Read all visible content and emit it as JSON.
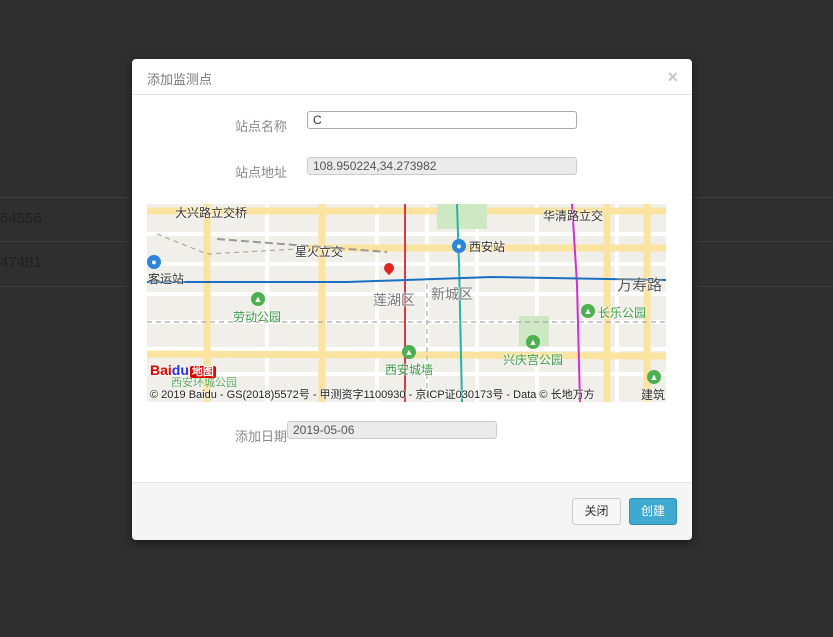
{
  "background": {
    "row1_value": "64556",
    "row2_value": "47481"
  },
  "modal": {
    "title": "添加监测点",
    "close_symbol": "×",
    "form": {
      "station_name_label": "站点名称",
      "station_name_value": "C",
      "station_address_label": "站点地址",
      "station_address_value": "108.950224,34.273982",
      "add_date_label": "添加日期",
      "add_date_value": "2019-05-06"
    },
    "map": {
      "labels": {
        "daxinglu": "大兴路立交桥",
        "huaqinglu": "华清路立交",
        "xinghuo": "星火立交",
        "xian_station": "西安站",
        "keyunzhan": "客运站",
        "wanshoulu": "万寿路",
        "lianhu": "莲湖区",
        "xincheng": "新城区",
        "laodong_park": "劳动公园",
        "changle_park": "长乐公园",
        "xingqing_park": "兴庆宫公园",
        "xian_wall": "西安城墙",
        "partial_park": "西安环城公园",
        "jianzhu": "建筑"
      },
      "logo_bai": "Bai",
      "logo_paw": "du",
      "logo_ditu": "地图",
      "copyright": "© 2019 Baidu - GS(2018)5572号 - 甲测资字1100930 - 京ICP证030173号 - Data © 长地万方"
    },
    "buttons": {
      "close_label": "关闭",
      "create_label": "创建"
    }
  },
  "colors": {
    "overlay": "#2f2f2f",
    "primary_button": "#3fa9cf",
    "metro_line_blue": "#1a6fc2",
    "metro_line_red": "#d63a45",
    "metro_line_teal": "#2ab0a6",
    "metro_line_magenta": "#d12fcf"
  },
  "icons": {
    "park": "tree-icon",
    "metro": "metro-icon",
    "location": "map-marker-icon"
  }
}
